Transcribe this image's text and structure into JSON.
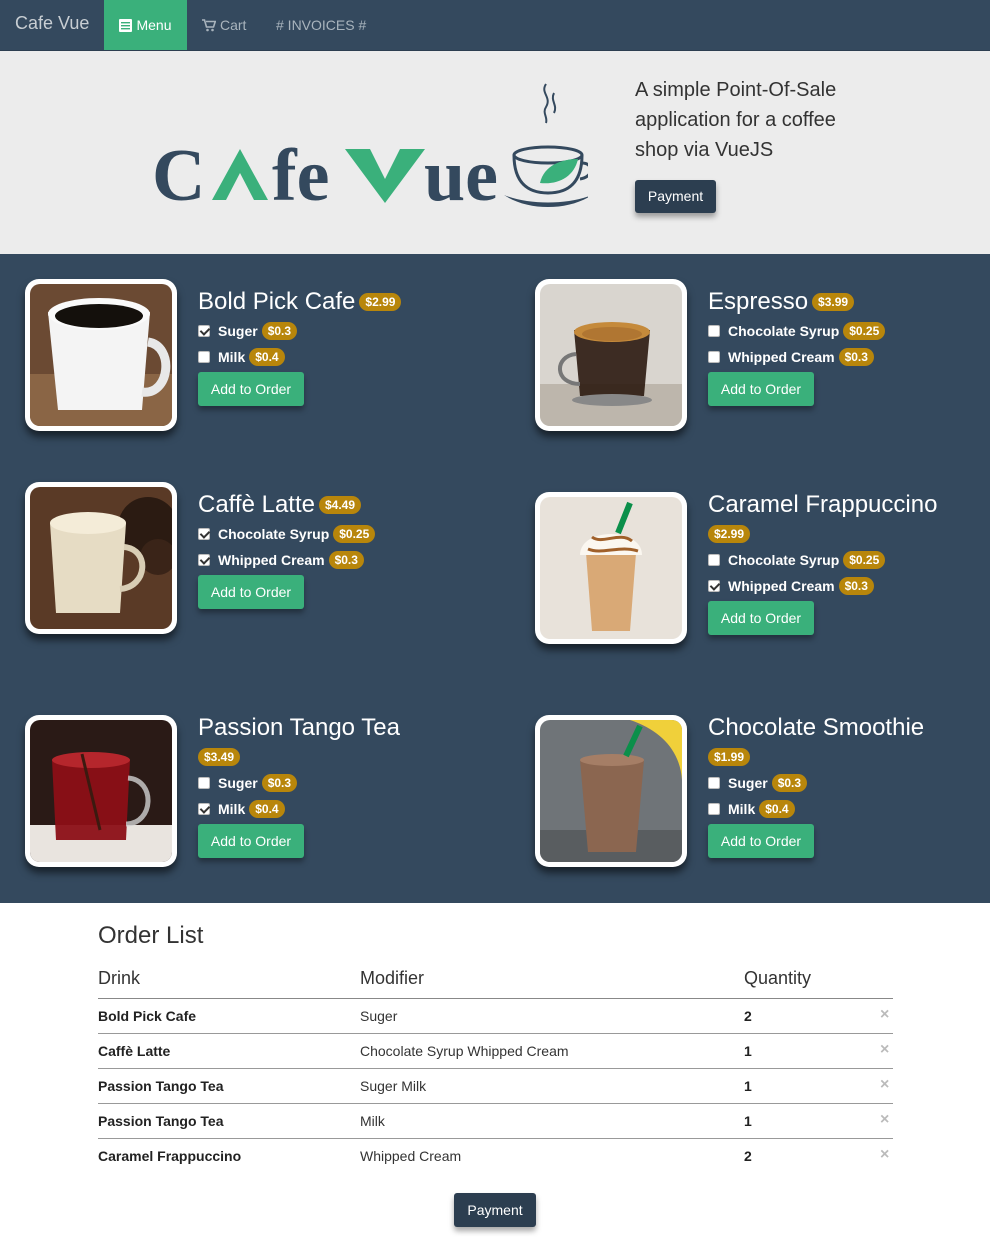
{
  "nav": {
    "brand": "Cafe Vue",
    "menu": "Menu",
    "cart": "Cart",
    "invoices": "# INVOICES #"
  },
  "hero": {
    "logo_text": "CAfe Vue",
    "tagline": "A simple Point-Of-Sale application for a coffee shop via VueJS",
    "payment_label": "Payment"
  },
  "drinks": [
    {
      "name": "Bold Pick Cafe",
      "price": "$2.99",
      "modifiers": [
        {
          "label": "Suger",
          "price": "$0.3",
          "checked": true
        },
        {
          "label": "Milk",
          "price": "$0.4",
          "checked": false
        }
      ],
      "button": "Add to Order"
    },
    {
      "name": "Espresso",
      "price": "$3.99",
      "modifiers": [
        {
          "label": "Chocolate Syrup",
          "price": "$0.25",
          "checked": false
        },
        {
          "label": "Whipped Cream",
          "price": "$0.3",
          "checked": false
        }
      ],
      "button": "Add to Order"
    },
    {
      "name": "Caffè Latte",
      "price": "$4.49",
      "modifiers": [
        {
          "label": "Chocolate Syrup",
          "price": "$0.25",
          "checked": true
        },
        {
          "label": "Whipped Cream",
          "price": "$0.3",
          "checked": true
        }
      ],
      "button": "Add to Order"
    },
    {
      "name": "Caramel Frappuccino",
      "price": "$2.99",
      "modifiers": [
        {
          "label": "Chocolate Syrup",
          "price": "$0.25",
          "checked": false
        },
        {
          "label": "Whipped Cream",
          "price": "$0.3",
          "checked": true
        }
      ],
      "button": "Add to Order"
    },
    {
      "name": "Passion Tango Tea",
      "price": "$3.49",
      "modifiers": [
        {
          "label": "Suger",
          "price": "$0.3",
          "checked": false
        },
        {
          "label": "Milk",
          "price": "$0.4",
          "checked": true
        }
      ],
      "button": "Add to Order"
    },
    {
      "name": "Chocolate Smoothie",
      "price": "$1.99",
      "modifiers": [
        {
          "label": "Suger",
          "price": "$0.3",
          "checked": false
        },
        {
          "label": "Milk",
          "price": "$0.4",
          "checked": false
        }
      ],
      "button": "Add to Order"
    }
  ],
  "orders": {
    "title": "Order List",
    "columns": [
      "Drink",
      "Modifier",
      "Quantity"
    ],
    "rows": [
      {
        "drink": "Bold Pick Cafe",
        "modifier": "Suger",
        "qty": "2"
      },
      {
        "drink": "Caffè Latte",
        "modifier": "Chocolate Syrup Whipped Cream",
        "qty": "1"
      },
      {
        "drink": "Passion Tango Tea",
        "modifier": "Suger Milk",
        "qty": "1"
      },
      {
        "drink": "Passion Tango Tea",
        "modifier": "Milk",
        "qty": "1"
      },
      {
        "drink": "Caramel Frappuccino",
        "modifier": "Whipped Cream",
        "qty": "2"
      }
    ],
    "remove_icon": "×",
    "payment_label": "Payment"
  },
  "colors": {
    "nav_bg": "#34495e",
    "accent_green": "#3ab07b",
    "badge_gold": "#b8860b",
    "dark_button": "#2c3e50"
  }
}
